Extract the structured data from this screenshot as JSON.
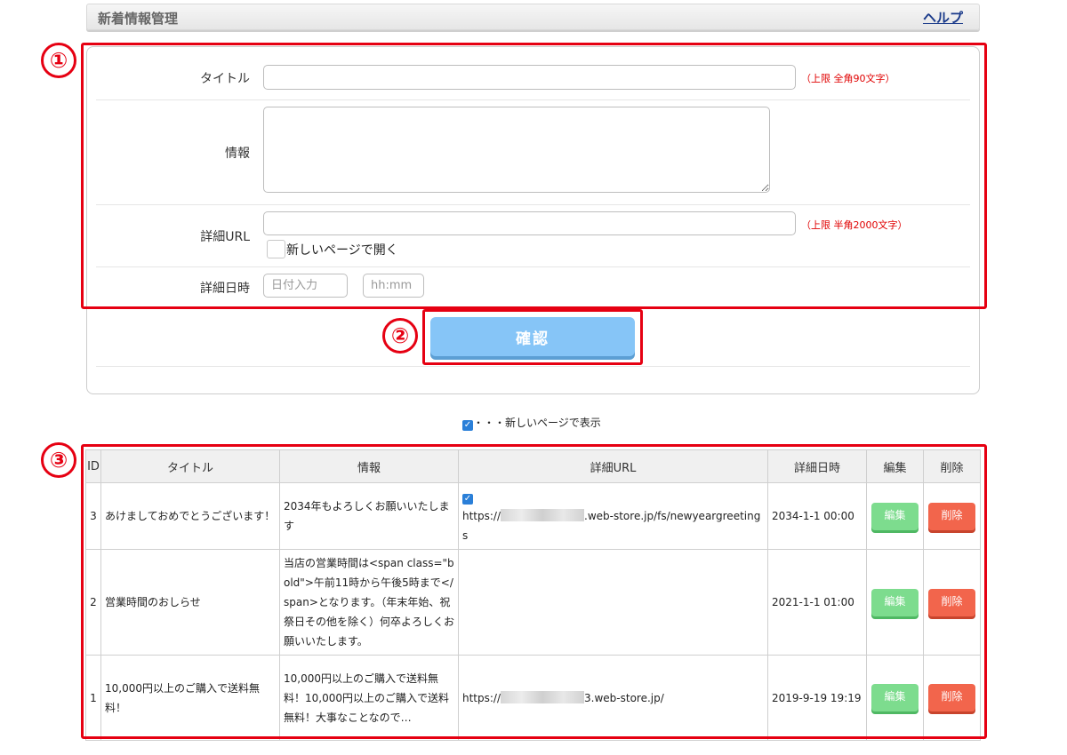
{
  "header": {
    "title": "新着情報管理",
    "help_label": "ヘルプ"
  },
  "form": {
    "title_label": "タイトル",
    "title_value": "",
    "title_limit": "（上限 全角90文字）",
    "info_label": "情報",
    "info_value": "",
    "url_label": "詳細URL",
    "url_value": "",
    "url_limit": "（上限 半角2000文字）",
    "new_page_label": "新しいページで開く",
    "new_page_checked": false,
    "datetime_label": "詳細日時",
    "date_placeholder": "日付入力",
    "time_placeholder": "hh:mm",
    "confirm_label": "確認"
  },
  "annotations": {
    "one": "①",
    "two": "②",
    "three": "③"
  },
  "legend": {
    "text": "・・・新しいページで表示"
  },
  "table": {
    "headers": {
      "id": "ID",
      "title": "タイトル",
      "info": "情報",
      "url": "詳細URL",
      "datetime": "詳細日時",
      "edit": "編集",
      "delete": "削除"
    },
    "rows": [
      {
        "id": "3",
        "title": "あけましておめでとうございます！",
        "info": "2034年もよろしくお願いいたします",
        "new_page": true,
        "url_prefix": "https://",
        "url_suffix": ".web-store.jp/fs/newyeargreetings",
        "datetime": "2034-1-1 00:00",
        "edit_label": "編集",
        "delete_label": "削除"
      },
      {
        "id": "2",
        "title": "営業時間のおしらせ",
        "info": "当店の営業時間は<span class=\"bold\">午前11時から午後5時まで</span>となります。（年末年始、祝祭日その他を除く）何卒よろしくお願いいたします。",
        "new_page": false,
        "url_prefix": "",
        "url_suffix": "",
        "datetime": "2021-1-1 01:00",
        "edit_label": "編集",
        "delete_label": "削除"
      },
      {
        "id": "1",
        "title": "10,000円以上のご購入で送料無料！",
        "info": "10,000円以上のご購入で送料無料！10,000円以上のご購入で送料無料！大事なことなので…",
        "new_page": false,
        "url_prefix": "https://",
        "url_suffix": "3.web-store.jp/",
        "datetime": "2019-9-19 19:19",
        "edit_label": "編集",
        "delete_label": "削除"
      }
    ]
  }
}
